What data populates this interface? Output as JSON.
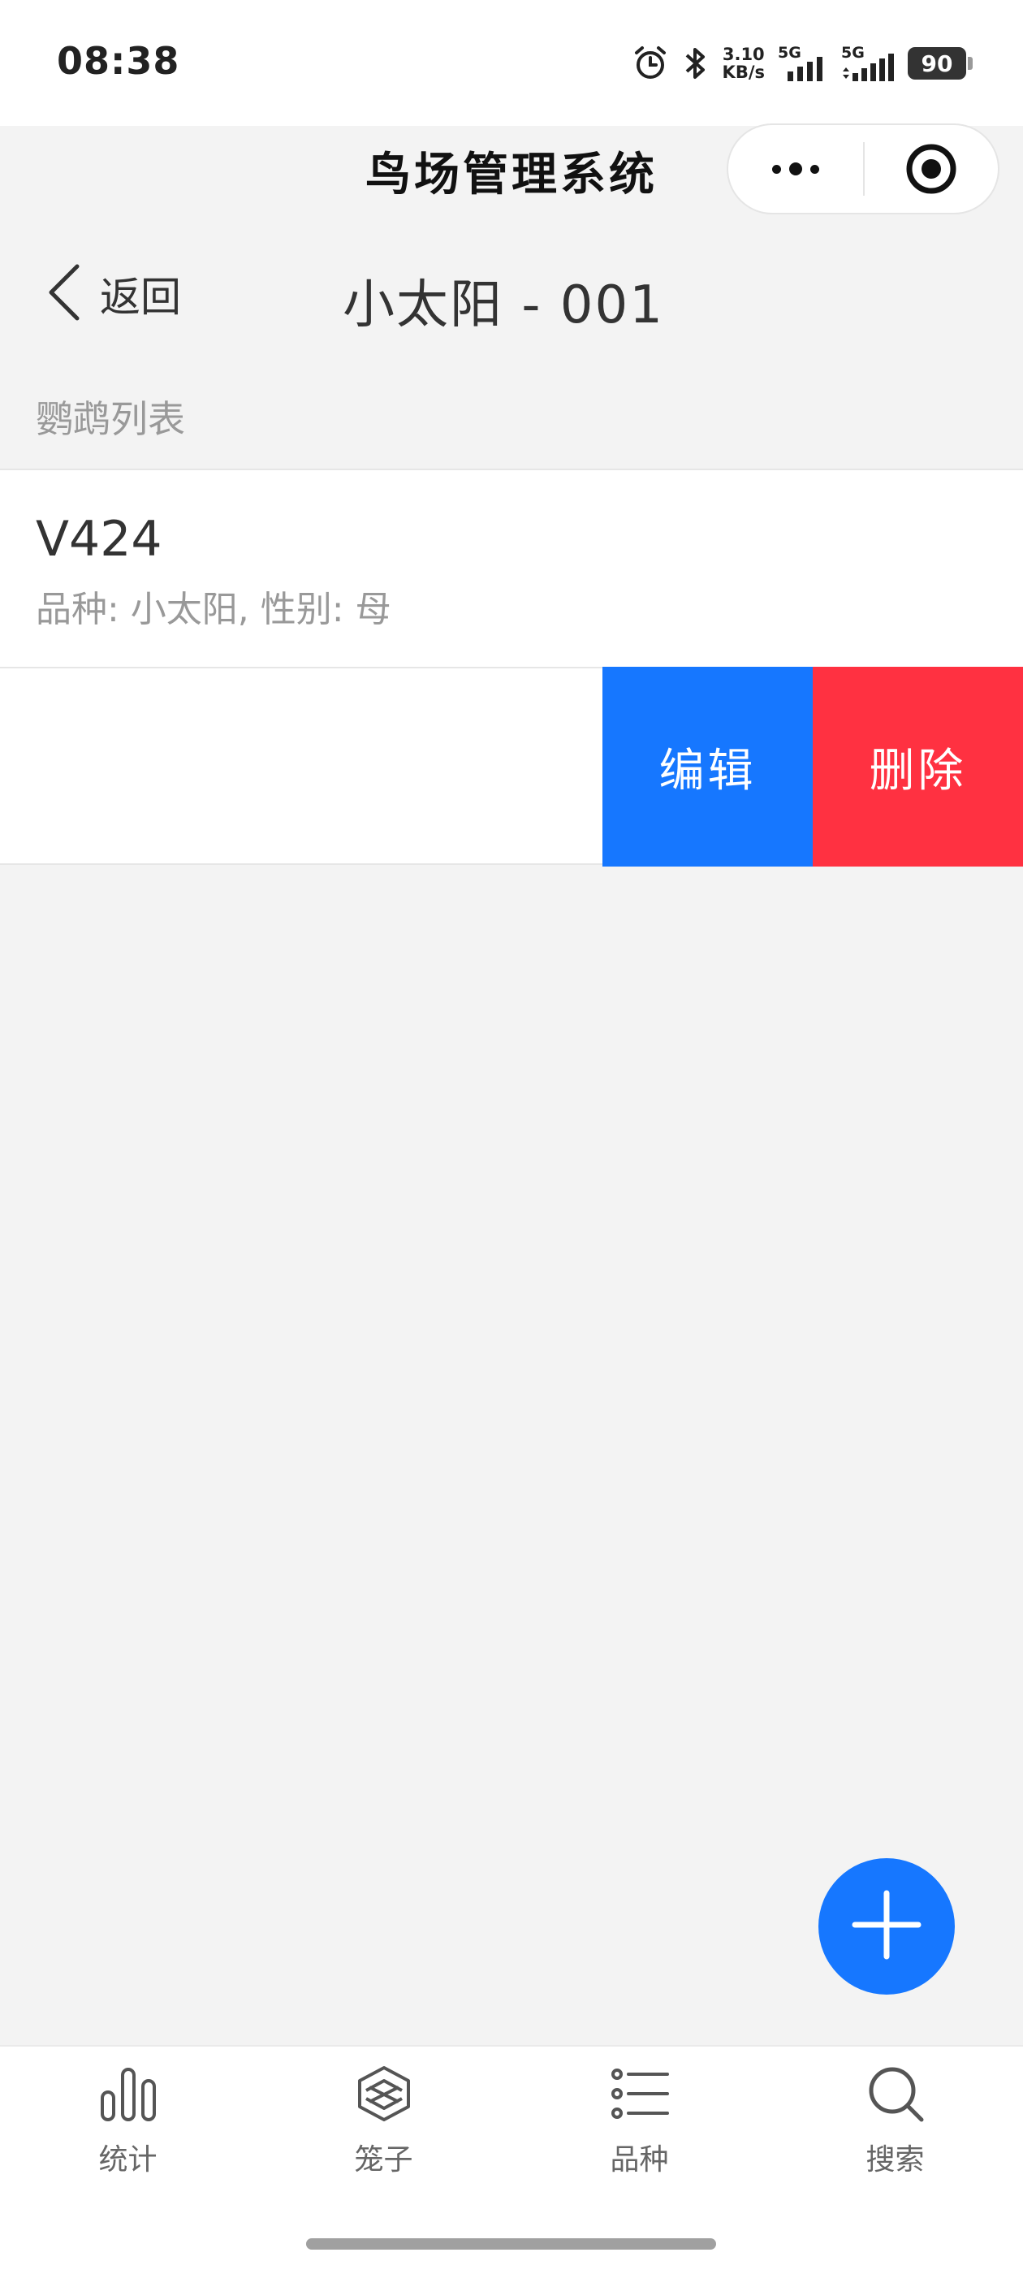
{
  "status_bar": {
    "time": "08:38",
    "net_speed_value": "3.10",
    "net_speed_unit": "KB/s",
    "signal_1_label": "5G",
    "signal_2_label": "5G",
    "battery": "90",
    "icons": [
      "alarm-icon",
      "bluetooth-icon",
      "signal-icon",
      "battery-icon"
    ]
  },
  "header": {
    "app_title": "鸟场管理系统",
    "capsule": {
      "more_icon": "more-dots-icon",
      "close_icon": "target-circle-icon"
    }
  },
  "navbar": {
    "back_label": "返回",
    "title": "小太阳 - 001"
  },
  "section": {
    "title": "鹦鹉列表"
  },
  "list": {
    "items": [
      {
        "title": "V424",
        "subtitle": "品种: 小太阳, 性别: 母"
      },
      {
        "title": "",
        "subtitle": "",
        "actions": {
          "edit": "编辑",
          "delete": "删除"
        }
      }
    ]
  },
  "fab": {
    "icon": "plus-icon"
  },
  "tabbar": {
    "tabs": [
      {
        "label": "统计",
        "icon": "bar-chart-icon"
      },
      {
        "label": "笼子",
        "icon": "cage-icon"
      },
      {
        "label": "品种",
        "icon": "list-icon"
      },
      {
        "label": "搜索",
        "icon": "search-icon"
      }
    ]
  },
  "colors": {
    "primary": "#1677ff",
    "danger": "#ff3141",
    "background": "#f3f3f3"
  }
}
